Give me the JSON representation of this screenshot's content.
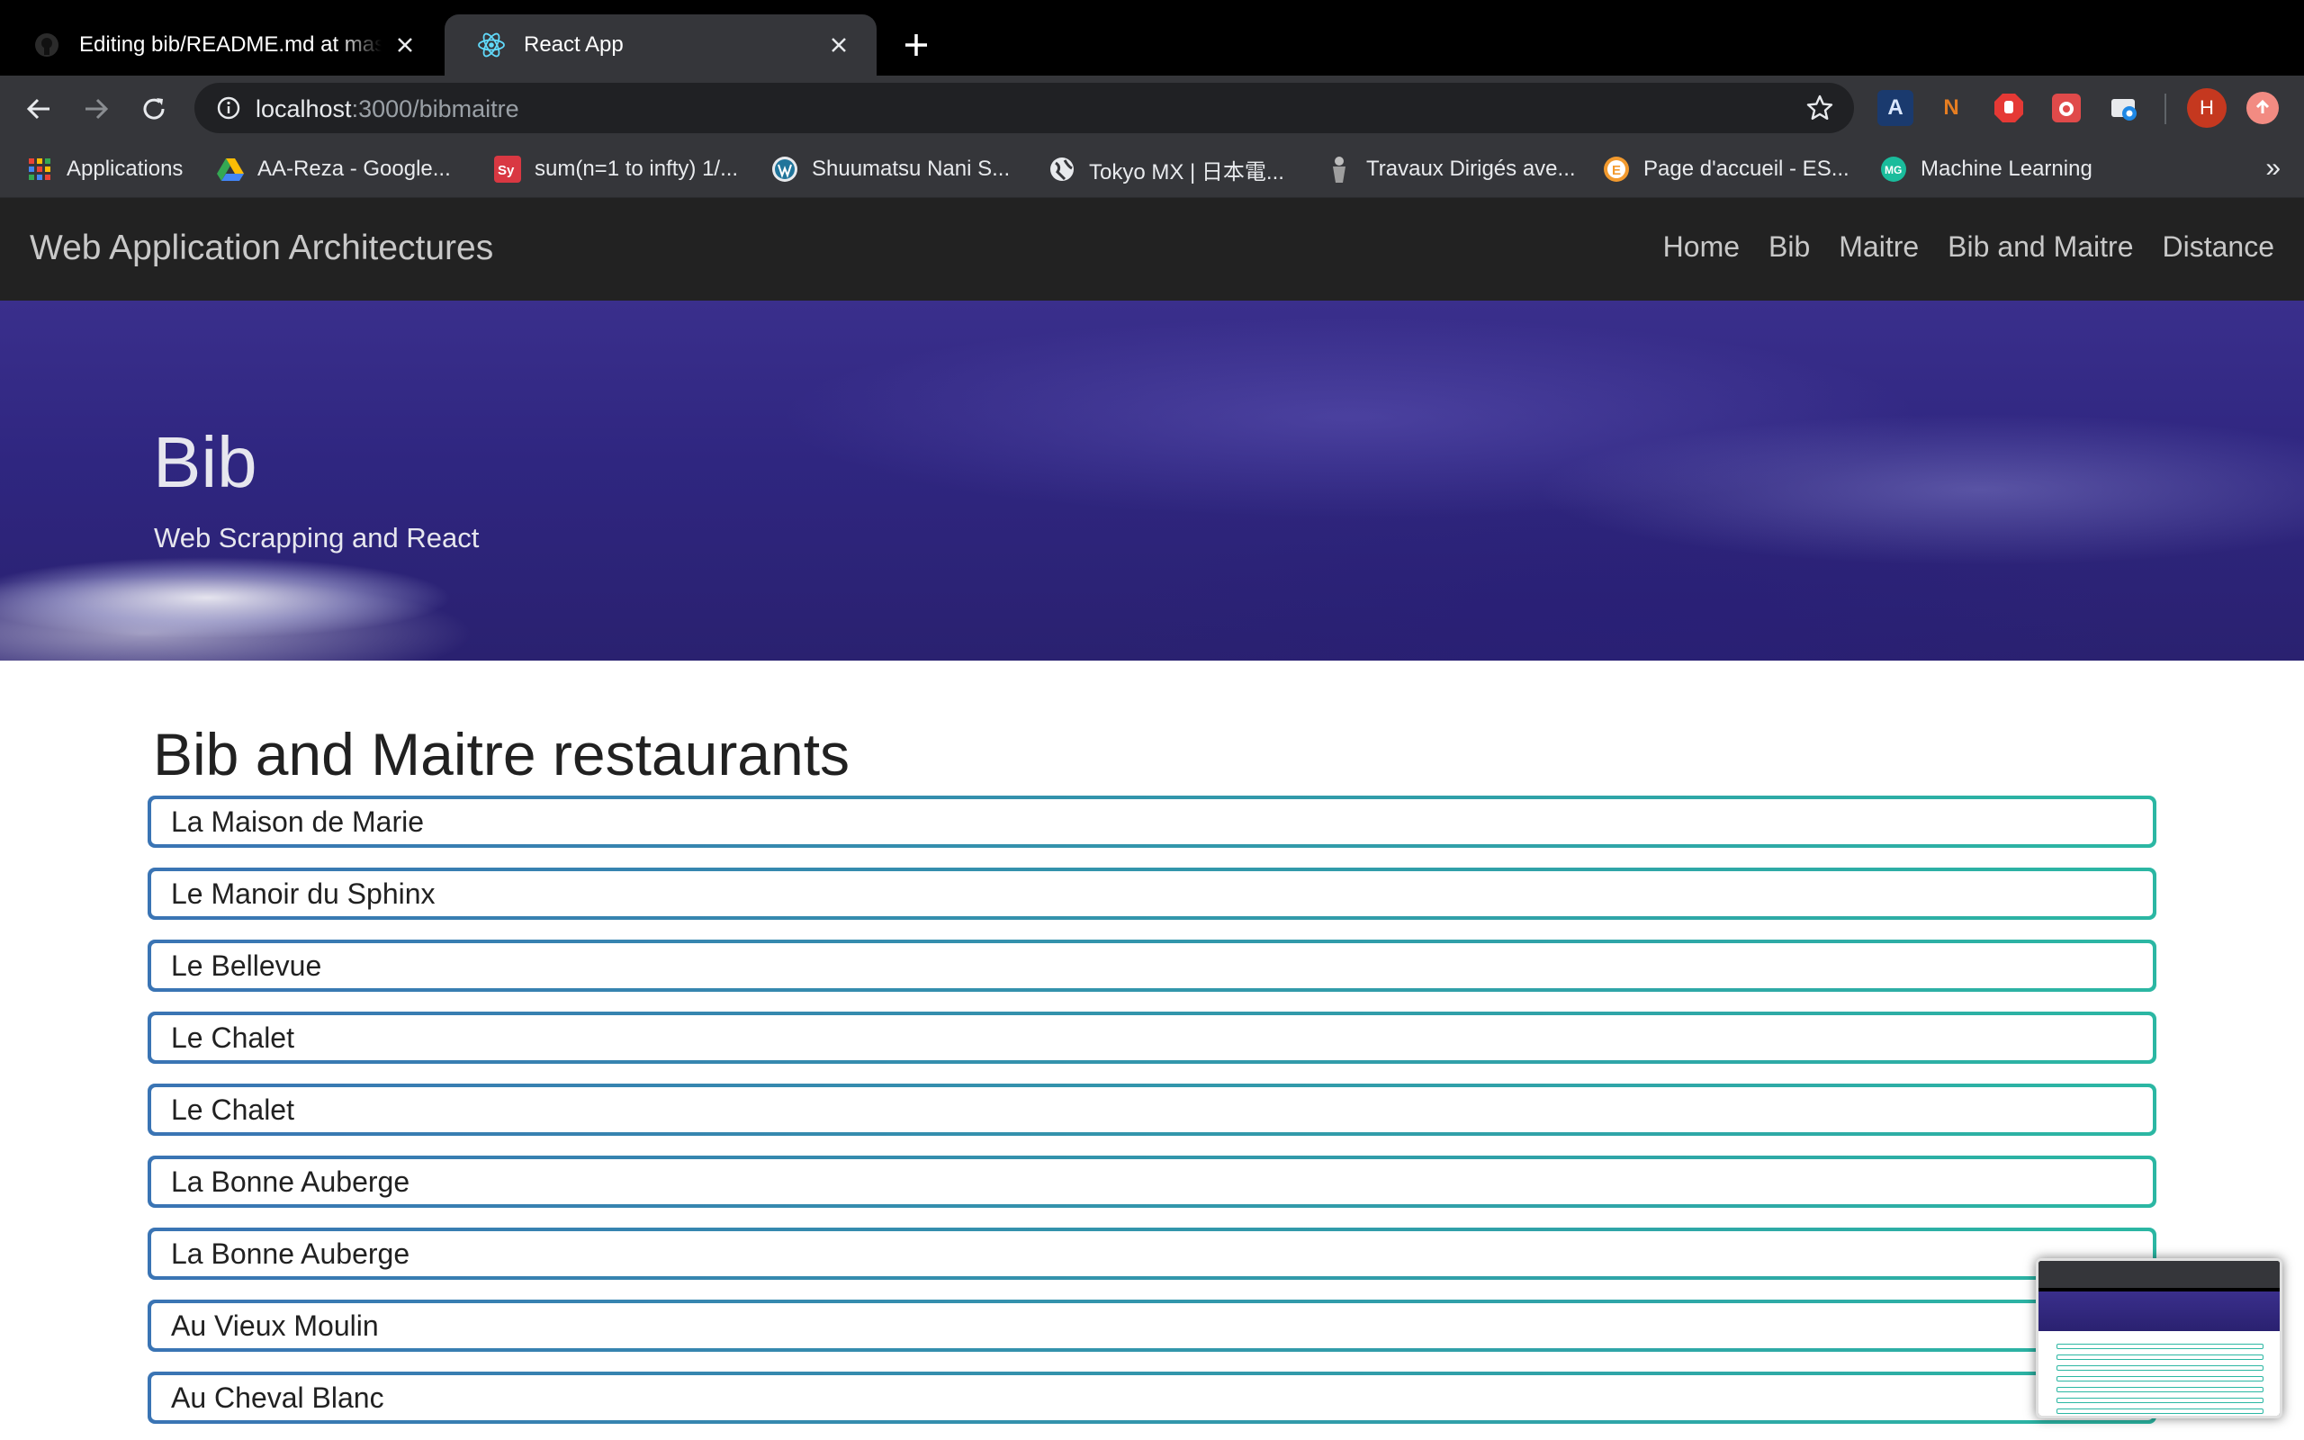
{
  "browser": {
    "tabs": [
      {
        "title": "Editing bib/README.md at master",
        "active": false,
        "favicon": "github-icon"
      },
      {
        "title": "React App",
        "active": true,
        "favicon": "react-icon"
      }
    ],
    "url": {
      "host": "localhost",
      "path": ":3000/bibmaitre"
    },
    "bookmarks": [
      {
        "label": "Applications",
        "icon": "apps-grid-icon"
      },
      {
        "label": "AA-Reza - Google...",
        "icon": "google-drive-icon"
      },
      {
        "label": "sum(n=1 to infty) 1/...",
        "icon": "symbolab-icon"
      },
      {
        "label": "Shuumatsu Nani S...",
        "icon": "wordpress-icon"
      },
      {
        "label": "Tokyo MX | 日本電...",
        "icon": "globe-icon"
      },
      {
        "label": "Travaux Dirigés ave...",
        "icon": "figure-icon"
      },
      {
        "label": "Page d'accueil - ES...",
        "icon": "esilv-icon"
      },
      {
        "label": "Machine Learning",
        "icon": "ml-icon"
      }
    ],
    "extensions": {
      "ext1": "A",
      "ext2": "N",
      "avatar": "H"
    },
    "overflow": "»"
  },
  "app": {
    "brand": "Web Application Architectures",
    "nav": [
      "Home",
      "Bib",
      "Maitre",
      "Bib and Maitre",
      "Distance"
    ]
  },
  "hero": {
    "title": "Bib",
    "subtitle": "Web Scrapping and React"
  },
  "main": {
    "heading": "Bib and Maitre restaurants",
    "restaurants": [
      "La Maison de Marie",
      "Le Manoir du Sphinx",
      "Le Bellevue",
      "Le Chalet",
      "Le Chalet",
      "La Bonne Auberge",
      "La Bonne Auberge",
      "Au Vieux Moulin",
      "Au Cheval Blanc"
    ]
  },
  "colors": {
    "list_border_start": "#3a74b4",
    "list_border_end": "#2bb7a3",
    "navbar_bg": "#222222",
    "hero_bg": "#2f2680"
  }
}
